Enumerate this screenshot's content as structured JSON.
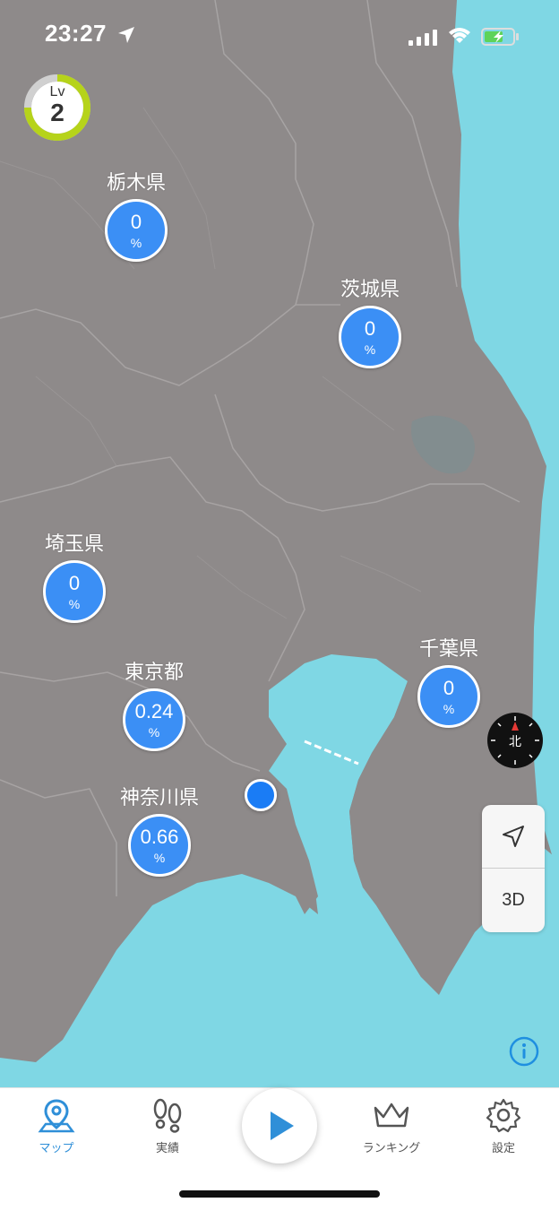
{
  "status_bar": {
    "time": "23:27"
  },
  "level": {
    "label": "Lv",
    "value": "2"
  },
  "prefectures": [
    {
      "name": "栃木県",
      "percent": "0",
      "unit": "%"
    },
    {
      "name": "茨城県",
      "percent": "0",
      "unit": "%"
    },
    {
      "name": "埼玉県",
      "percent": "0",
      "unit": "%"
    },
    {
      "name": "東京都",
      "percent": "0.24",
      "unit": "%"
    },
    {
      "name": "千葉県",
      "percent": "0",
      "unit": "%"
    },
    {
      "name": "神奈川県",
      "percent": "0.66",
      "unit": "%"
    }
  ],
  "compass": {
    "label": "北"
  },
  "map_controls": {
    "mode_3d": "3D"
  },
  "tabs": [
    {
      "label": "マップ",
      "icon": "map-pin-icon",
      "active": true
    },
    {
      "label": "実績",
      "icon": "footprints-icon",
      "active": false
    },
    {
      "label": "ランキング",
      "icon": "crown-icon",
      "active": false
    },
    {
      "label": "設定",
      "icon": "gear-icon",
      "active": false
    }
  ],
  "colors": {
    "land": "#8e8a8a",
    "sea": "#7fd7e4",
    "bubble": "#3b8ff5",
    "accent": "#2f8fd8",
    "level_ring": "#b6d31a"
  }
}
